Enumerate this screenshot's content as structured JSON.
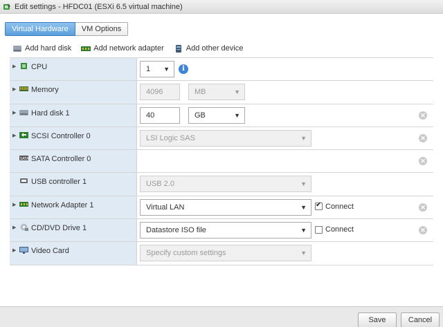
{
  "window": {
    "title": "Edit settings - HFDC01 (ESXi 6.5 virtual machine)"
  },
  "tabs": [
    {
      "label": "Virtual Hardware",
      "active": true
    },
    {
      "label": "VM Options",
      "active": false
    }
  ],
  "toolbar": {
    "add_hard_disk": "Add hard disk",
    "add_network_adapter": "Add network adapter",
    "add_other_device": "Add other device"
  },
  "devices": {
    "cpu": {
      "label": "CPU",
      "value": "1",
      "icon": "cpu-icon"
    },
    "memory": {
      "label": "Memory",
      "value": "4096",
      "unit": "MB",
      "icon": "memory-icon"
    },
    "hard_disk": {
      "label": "Hard disk 1",
      "value": "40",
      "unit": "GB",
      "icon": "hard-disk-icon"
    },
    "scsi": {
      "label": "SCSI Controller 0",
      "value": "LSI Logic SAS",
      "icon": "scsi-icon"
    },
    "sata": {
      "label": "SATA Controller 0",
      "icon": "sata-icon"
    },
    "usb": {
      "label": "USB controller 1",
      "value": "USB 2.0",
      "icon": "usb-icon"
    },
    "network": {
      "label": "Network Adapter 1",
      "value": "Virtual LAN",
      "connect_label": "Connect",
      "connected": true,
      "icon": "network-icon"
    },
    "cddvd": {
      "label": "CD/DVD Drive 1",
      "value": "Datastore ISO file",
      "connect_label": "Connect",
      "connected": false,
      "icon": "cd-dvd-icon"
    },
    "video": {
      "label": "Video Card",
      "value": "Specify custom settings",
      "icon": "video-card-icon"
    }
  },
  "footer": {
    "save": "Save",
    "cancel": "Cancel"
  },
  "colors": {
    "accent": "#5c9fdc",
    "row_label_bg": "#dfeaf4",
    "info": "#3d86d4"
  }
}
